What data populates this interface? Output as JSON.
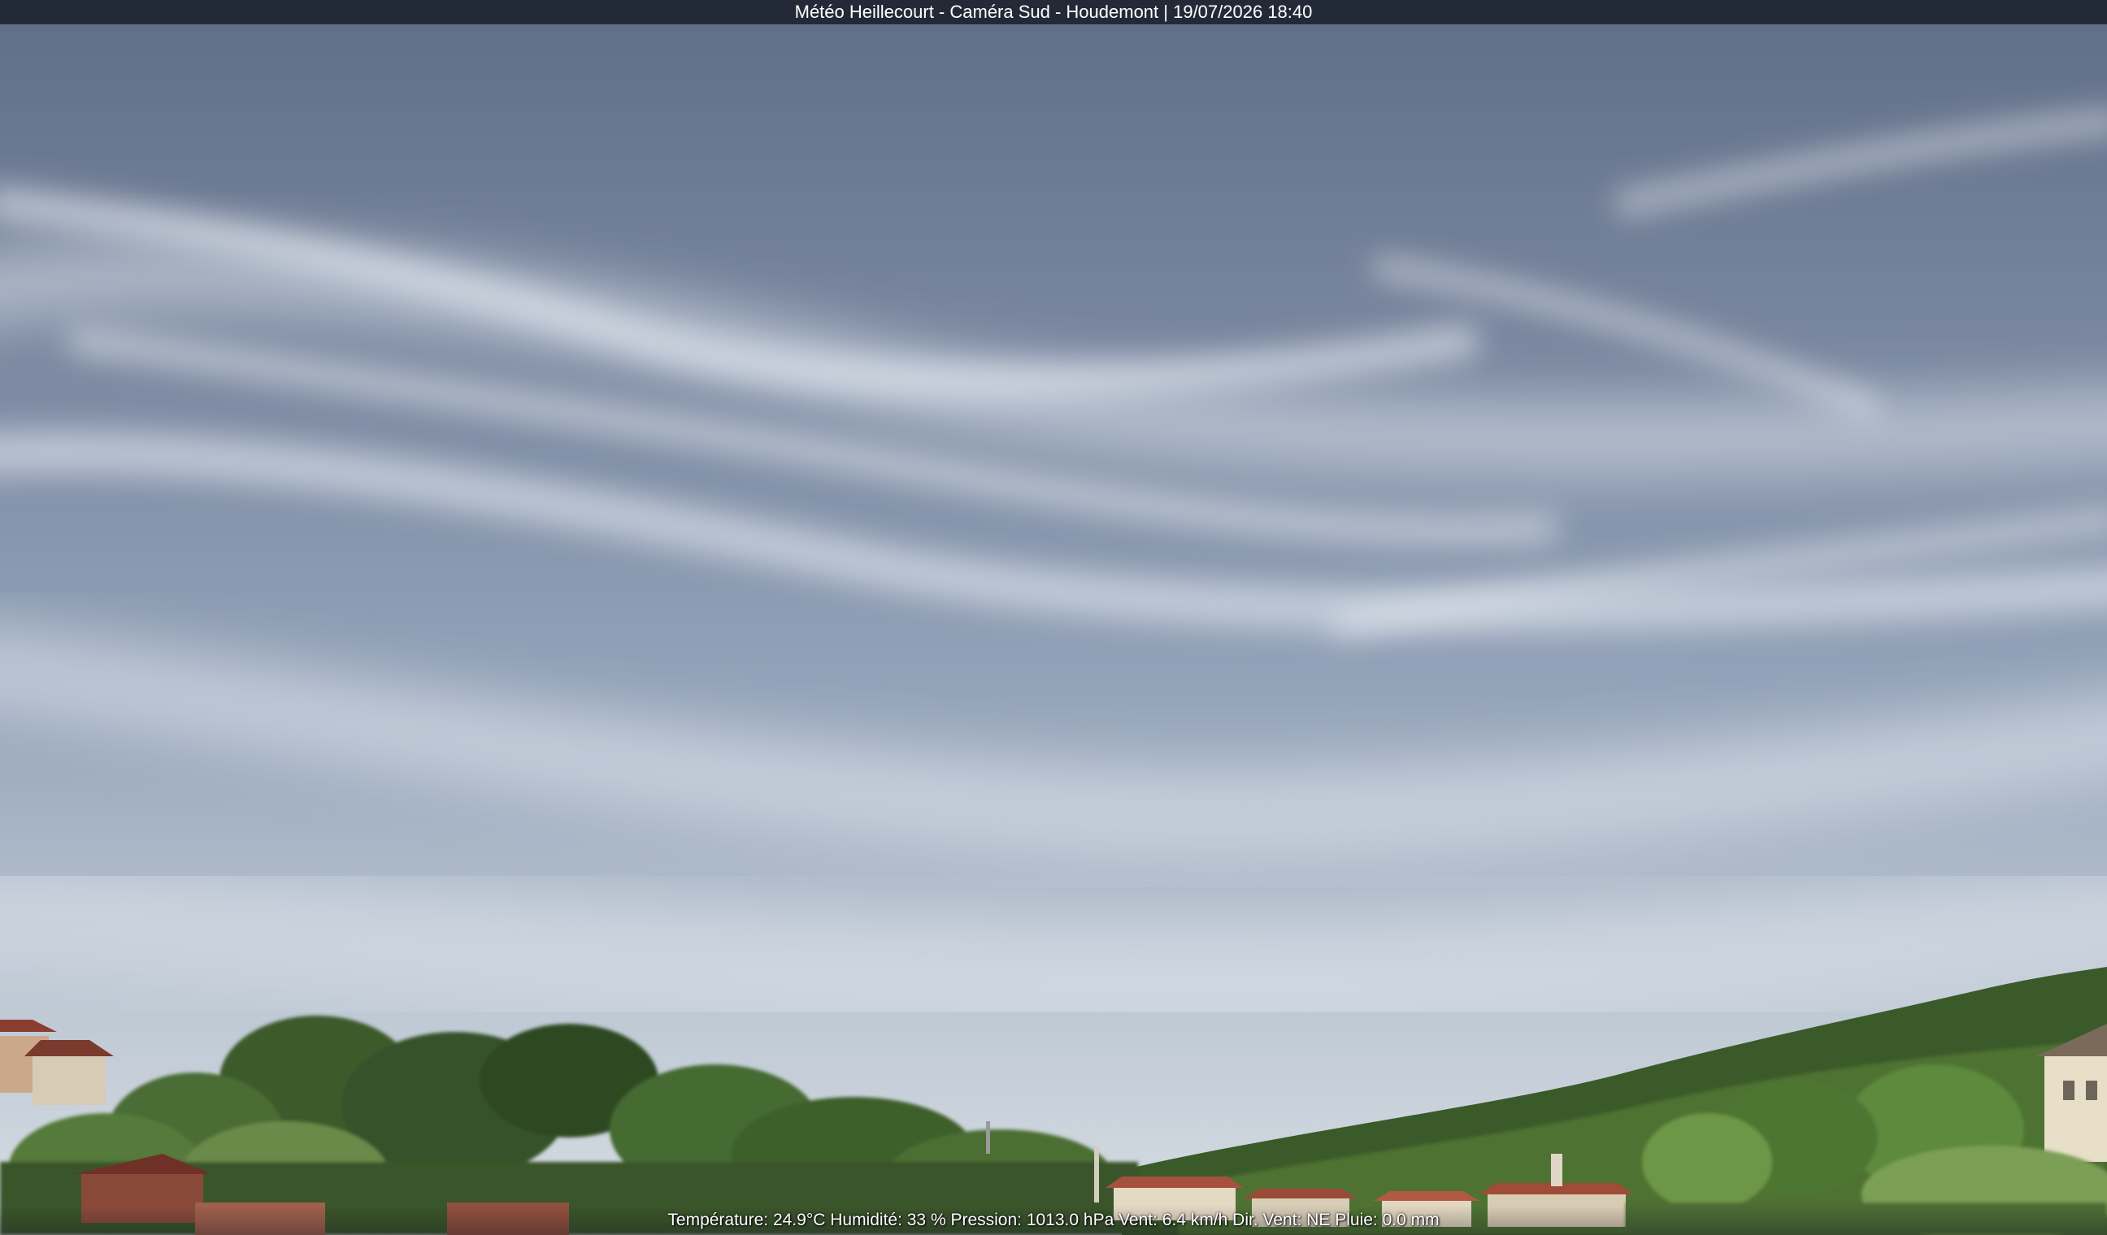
{
  "overlay": {
    "title": "Météo Heillecourt - Caméra Sud - Houdemont | 19/07/2026 18:40",
    "weather_line": "Température: 24.9°C  Humidité: 33 % Pression: 1013.0 hPa Vent: 6.4 km/h Dir. Vent: NE Pluie: 0.0 mm"
  },
  "scene": {
    "description_colors": {
      "sky_top": "#66758e",
      "sky_mid": "#8d9bb2",
      "sky_horizon": "#c9d2dc",
      "cloud": "#e6ebf1",
      "foliage_dark": "#2f4a24",
      "foliage_light": "#5e7f3c",
      "roof": "#a4523e",
      "wall": "#e4d9c3"
    }
  }
}
